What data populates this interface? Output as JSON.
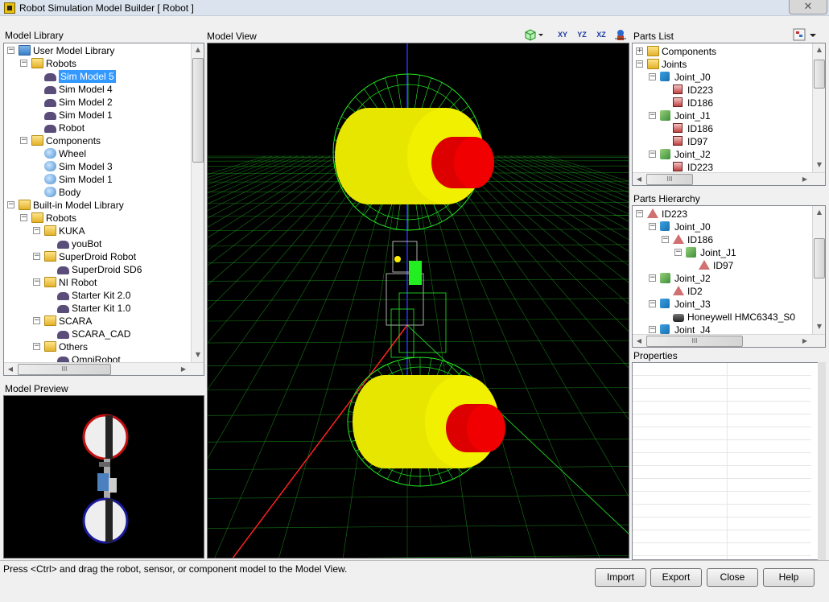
{
  "window": {
    "title": "Robot Simulation Model Builder    [ Robot ]",
    "close_glyph": "✕"
  },
  "panels": {
    "model_library": "Model Library",
    "model_view": "Model View",
    "parts_list": "Parts List",
    "model_preview": "Model Preview",
    "parts_hierarchy": "Parts Hierarchy",
    "properties": "Properties"
  },
  "model_library_tree": [
    {
      "label": "User Model Library",
      "level": 0,
      "icon": "folder-blue",
      "expander": "−"
    },
    {
      "label": "Robots",
      "level": 1,
      "icon": "folder-yellow",
      "expander": "−"
    },
    {
      "label": "Sim Model 5",
      "level": 2,
      "icon": "robot",
      "selected": true
    },
    {
      "label": "Sim Model 4",
      "level": 2,
      "icon": "robot"
    },
    {
      "label": "Sim Model 2",
      "level": 2,
      "icon": "robot"
    },
    {
      "label": "Sim Model 1",
      "level": 2,
      "icon": "robot"
    },
    {
      "label": "Robot",
      "level": 2,
      "icon": "robot"
    },
    {
      "label": "Components",
      "level": 1,
      "icon": "folder-yellow",
      "expander": "−"
    },
    {
      "label": "Wheel",
      "level": 2,
      "icon": "comp"
    },
    {
      "label": "Sim Model 3",
      "level": 2,
      "icon": "comp"
    },
    {
      "label": "Sim Model 1",
      "level": 2,
      "icon": "comp"
    },
    {
      "label": "Body",
      "level": 2,
      "icon": "comp"
    },
    {
      "label": "Built-in Model Library",
      "level": 0,
      "icon": "folder-yellow",
      "expander": "−"
    },
    {
      "label": "Robots",
      "level": 1,
      "icon": "folder-yellow",
      "expander": "−"
    },
    {
      "label": "KUKA",
      "level": 2,
      "icon": "folder-yellow",
      "expander": "−"
    },
    {
      "label": "youBot",
      "level": 3,
      "icon": "robot"
    },
    {
      "label": "SuperDroid Robot",
      "level": 2,
      "icon": "folder-yellow",
      "expander": "−"
    },
    {
      "label": "SuperDroid SD6",
      "level": 3,
      "icon": "robot"
    },
    {
      "label": "NI Robot",
      "level": 2,
      "icon": "folder-yellow",
      "expander": "−"
    },
    {
      "label": "Starter Kit 2.0",
      "level": 3,
      "icon": "robot"
    },
    {
      "label": "Starter Kit 1.0",
      "level": 3,
      "icon": "robot"
    },
    {
      "label": "SCARA",
      "level": 2,
      "icon": "folder-yellow",
      "expander": "−"
    },
    {
      "label": "SCARA_CAD",
      "level": 3,
      "icon": "robot"
    },
    {
      "label": "Others",
      "level": 2,
      "icon": "folder-yellow",
      "expander": "−"
    },
    {
      "label": "OmniRobot",
      "level": 3,
      "icon": "robot"
    }
  ],
  "parts_list_tree": [
    {
      "label": "Components",
      "level": 0,
      "icon": "folder-yellow",
      "expander": "+"
    },
    {
      "label": "Joints",
      "level": 0,
      "icon": "folder-yellow",
      "expander": "−"
    },
    {
      "label": "Joint_J0",
      "level": 1,
      "icon": "joint",
      "expander": "−"
    },
    {
      "label": "ID223",
      "level": 2,
      "icon": "part"
    },
    {
      "label": "ID186",
      "level": 2,
      "icon": "part"
    },
    {
      "label": "Joint_J1",
      "level": 1,
      "icon": "jointg",
      "expander": "−"
    },
    {
      "label": "ID186",
      "level": 2,
      "icon": "part"
    },
    {
      "label": "ID97",
      "level": 2,
      "icon": "part"
    },
    {
      "label": "Joint_J2",
      "level": 1,
      "icon": "jointg",
      "expander": "−"
    },
    {
      "label": "ID223",
      "level": 2,
      "icon": "part"
    }
  ],
  "parts_hierarchy_tree": [
    {
      "label": "ID223",
      "level": 0,
      "icon": "cone",
      "expander": "−"
    },
    {
      "label": "Joint_J0",
      "level": 1,
      "icon": "joint",
      "expander": "−"
    },
    {
      "label": "ID186",
      "level": 2,
      "icon": "cone",
      "expander": "−"
    },
    {
      "label": "Joint_J1",
      "level": 3,
      "icon": "jointg",
      "expander": "−"
    },
    {
      "label": "ID97",
      "level": 4,
      "icon": "cone"
    },
    {
      "label": "Joint_J2",
      "level": 1,
      "icon": "jointg",
      "expander": "−"
    },
    {
      "label": "ID2",
      "level": 2,
      "icon": "cone"
    },
    {
      "label": "Joint_J3",
      "level": 1,
      "icon": "joint",
      "expander": "−"
    },
    {
      "label": "Honeywell HMC6343_S0",
      "level": 2,
      "icon": "sensor"
    },
    {
      "label": "Joint_J4",
      "level": 1,
      "icon": "joint",
      "expander": "−"
    }
  ],
  "toolbar": {
    "view_xy": "XY",
    "view_yz": "YZ",
    "view_xz": "XZ"
  },
  "scrollbar": {
    "grip": "III",
    "up": "▲",
    "down": "▼",
    "left": "◀",
    "right": "▶"
  },
  "status_text": "Press <Ctrl> and drag the robot, sensor, or component model to the Model View.",
  "buttons": {
    "import": "Import",
    "export": "Export",
    "close": "Close",
    "help": "Help"
  },
  "colors": {
    "viewport_bg": "#000000",
    "grid": "#1f9a1f",
    "wheel_yellow": "#e6e600",
    "hub_red": "#dd0000",
    "wireframe": "#22ee22",
    "selection": "#3399ff"
  }
}
